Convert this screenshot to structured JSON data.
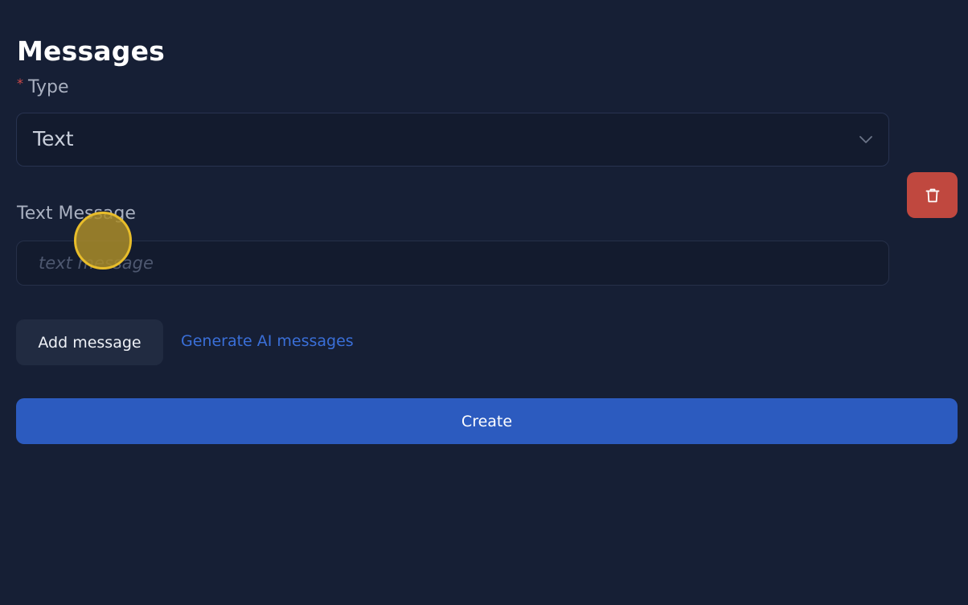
{
  "page": {
    "title": "Messages"
  },
  "type_field": {
    "required_marker": "*",
    "label": "Type",
    "selected_value": "Text"
  },
  "text_message_field": {
    "label": "Text Message",
    "value": "",
    "placeholder": "text message"
  },
  "actions": {
    "add_message_label": "Add message",
    "generate_ai_label": "Generate AI messages",
    "create_label": "Create"
  },
  "icons": {
    "delete": "trash-icon",
    "select": "chevron-down-icon"
  },
  "colors": {
    "background": "#161f35",
    "delete_button": "#c0483f",
    "primary_button": "#2c5bbf",
    "link": "#3a6fd8",
    "required_marker": "#d14a4a"
  }
}
